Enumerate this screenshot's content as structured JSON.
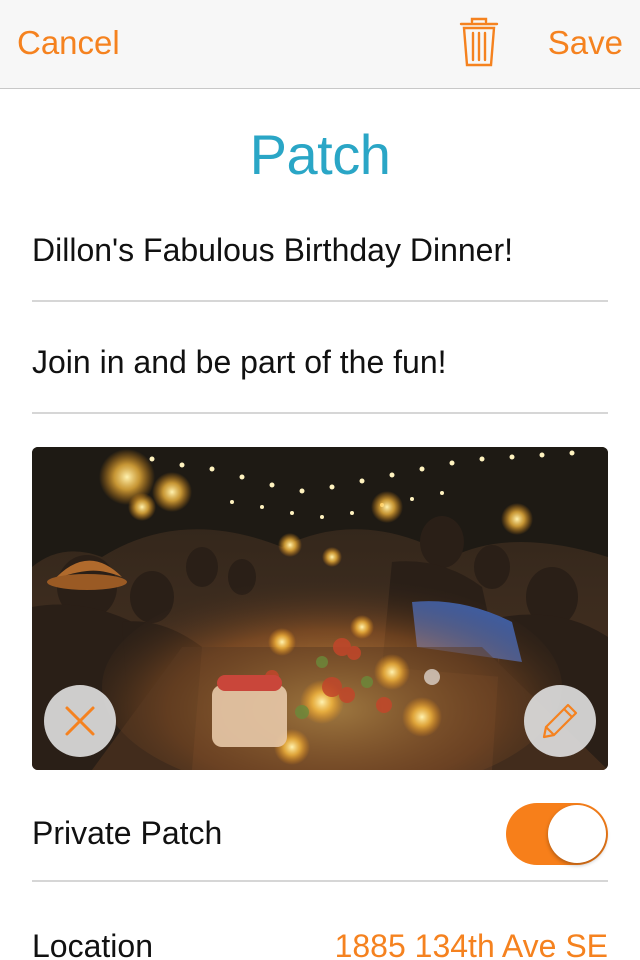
{
  "navbar": {
    "cancel_label": "Cancel",
    "save_label": "Save",
    "delete_icon": "trash-icon"
  },
  "form": {
    "title": "Patch",
    "name_value": "Dillon's Fabulous Birthday Dinner!",
    "description_value": "Join in and be part of the fun!"
  },
  "photo": {
    "remove_icon": "close-icon",
    "edit_icon": "pencil-icon"
  },
  "settings": {
    "private_label": "Private Patch",
    "private_on": true,
    "location_label": "Location",
    "location_value": "1885 134th Ave SE"
  },
  "colors": {
    "accent": "#f5821f",
    "title": "#2aa6c6",
    "toggle_on": "#f77f1a"
  }
}
